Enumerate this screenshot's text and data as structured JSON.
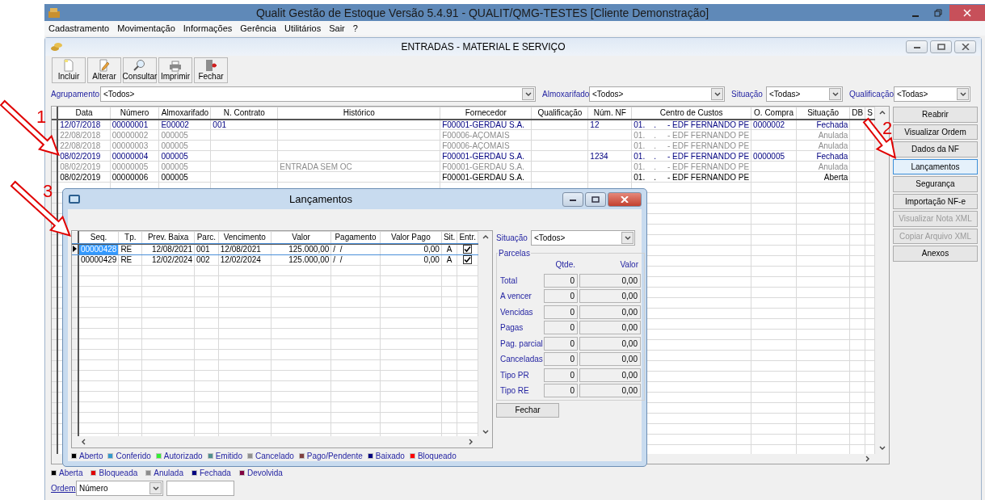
{
  "window": {
    "title": "Qualit Gestão de Estoque Versão 5.4.91 - QUALIT/QMG-TESTES [Cliente Demonstração]"
  },
  "menu": [
    "Cadastramento",
    "Movimentação",
    "Informações",
    "Gerência",
    "Utilitários",
    "Sair",
    "?"
  ],
  "child_window": {
    "title": "ENTRADAS - MATERIAL E SERVIÇO"
  },
  "toolbar": [
    {
      "label": "Incluir",
      "kind": "new"
    },
    {
      "label": "Alterar",
      "kind": "edit"
    },
    {
      "label": "Consultar",
      "kind": "search"
    },
    {
      "label": "Imprimir",
      "kind": "print"
    },
    {
      "label": "Fechar",
      "kind": "exit"
    }
  ],
  "filters": [
    {
      "label": "Agrupamento",
      "value": "<Todos>"
    },
    {
      "label": "Almoxarifado",
      "value": "<Todos>"
    },
    {
      "label": "Situação",
      "value": "<Todas>"
    },
    {
      "label": "Qualificação",
      "value": "<Todas>"
    }
  ],
  "table": {
    "columns": [
      "Data",
      "Número",
      "Almoxarifado",
      "N. Contrato",
      "Histórico",
      "Fornecedor",
      "Qualificação",
      "Núm. NF",
      "Centro de Custos",
      "O. Compra",
      "Situação",
      "DB",
      "S"
    ],
    "rows": [
      {
        "kind": "closed",
        "cells": [
          "12/07/2018",
          "00000001",
          "E00002",
          "001",
          "",
          "F00001-GERDAU S.A.",
          "",
          "12",
          "01.    .     - EDF FERNANDO PE",
          "0000002",
          "Fechada"
        ]
      },
      {
        "kind": "voided",
        "cells": [
          "22/08/2018",
          "00000002",
          "000005",
          "",
          "",
          "F00006-AÇOMAIS",
          "",
          "",
          "01.    .     - EDF FERNANDO PE",
          "",
          "Anulada"
        ]
      },
      {
        "kind": "voided",
        "cells": [
          "22/08/2018",
          "00000003",
          "000005",
          "",
          "",
          "F00006-AÇOMAIS",
          "",
          "",
          "01.    .     - EDF FERNANDO PE",
          "",
          "Anulada"
        ]
      },
      {
        "kind": "closed",
        "cells": [
          "08/02/2019",
          "00000004",
          "000005",
          "",
          "",
          "F00001-GERDAU S.A.",
          "",
          "1234",
          "01.    .     - EDF FERNANDO PE",
          "0000005",
          "Fechada"
        ]
      },
      {
        "kind": "voided",
        "cells": [
          "08/02/2019",
          "00000005",
          "000005",
          "",
          "ENTRADA SEM OC",
          "F00001-GERDAU S.A.",
          "",
          "",
          "01.    .     - EDF FERNANDO PE",
          "",
          "Anulada"
        ]
      },
      {
        "kind": "open",
        "cells": [
          "08/02/2019",
          "00000006",
          "000005",
          "",
          "",
          "F00001-GERDAU S.A.",
          "",
          "",
          "01.    .     - EDF FERNANDO PE",
          "",
          "Aberta"
        ]
      }
    ]
  },
  "side_buttons": [
    {
      "label": "Reabrir",
      "disabled": false,
      "focused": false
    },
    {
      "label": "Visualizar Ordem",
      "disabled": false,
      "focused": false
    },
    {
      "label": "Dados da NF",
      "disabled": false,
      "focused": false
    },
    {
      "label": "Lançamentos",
      "disabled": false,
      "focused": true
    },
    {
      "label": "Segurança",
      "disabled": false,
      "focused": false
    },
    {
      "label": "Importação NF-e",
      "disabled": false,
      "focused": false
    },
    {
      "label": "Visualizar Nota XML",
      "disabled": true,
      "focused": false
    },
    {
      "label": "Copiar Arquivo XML",
      "disabled": true,
      "focused": false
    },
    {
      "label": "Anexos",
      "disabled": false,
      "focused": false
    }
  ],
  "legend": [
    {
      "label": "Aberta",
      "color": "#000000"
    },
    {
      "label": "Bloqueada",
      "color": "#e00000"
    },
    {
      "label": "Anulada",
      "color": "#8c8c8c"
    },
    {
      "label": "Fechada",
      "color": "#000080"
    },
    {
      "label": "Devolvida",
      "color": "#800040"
    }
  ],
  "order": {
    "label": "Ordem",
    "value": "Número"
  },
  "dialog": {
    "title": "Lançamentos",
    "table": {
      "columns": [
        "Seq.",
        "Tp.",
        "Prev. Baixa",
        "Parc.",
        "Vencimento",
        "Valor",
        "Pagamento",
        "Valor Pago",
        "Sit.",
        "Entr."
      ],
      "rows": [
        {
          "selected": true,
          "checked": true,
          "cells": [
            "00000428",
            "RE",
            "12/08/2021",
            "001",
            "12/08/2021",
            "125.000,00",
            "/  /",
            "0,00",
            "A"
          ]
        },
        {
          "selected": false,
          "checked": true,
          "cells": [
            "00000429",
            "RE",
            "12/02/2024",
            "002",
            "12/02/2024",
            "125.000,00",
            "/  /",
            "0,00",
            "A"
          ]
        }
      ]
    },
    "status_filter": {
      "label": "Situação",
      "value": "<Todos>"
    },
    "summary": {
      "title": "Parcelas",
      "columns": [
        "Qtde.",
        "Valor"
      ],
      "rows": [
        {
          "label": "Total",
          "qty": "0",
          "value": "0,00"
        },
        {
          "label": "A vencer",
          "qty": "0",
          "value": "0,00"
        },
        {
          "label": "Vencidas",
          "qty": "0",
          "value": "0,00"
        },
        {
          "label": "Pagas",
          "qty": "0",
          "value": "0,00"
        },
        {
          "label": "Pag. parcial",
          "qty": "0",
          "value": "0,00"
        },
        {
          "label": "Canceladas",
          "qty": "0",
          "value": "0,00"
        },
        {
          "label": "Tipo PR",
          "qty": "0",
          "value": "0,00"
        },
        {
          "label": "Tipo RE",
          "qty": "0",
          "value": "0,00"
        }
      ]
    },
    "close_button": "Fechar",
    "legend": [
      {
        "label": "Aberto",
        "color": "#000000"
      },
      {
        "label": "Conferido",
        "color": "#3399cc"
      },
      {
        "label": "Autorizado",
        "color": "#33ee33"
      },
      {
        "label": "Emitido",
        "color": "#4f8f8f"
      },
      {
        "label": "Cancelado",
        "color": "#909090"
      },
      {
        "label": "Pago/Pendente",
        "color": "#804040"
      },
      {
        "label": "Baixado",
        "color": "#000080"
      },
      {
        "label": "Bloqueado",
        "color": "#ff0000"
      }
    ]
  },
  "annotations": [
    {
      "label": "1"
    },
    {
      "label": "2"
    },
    {
      "label": "3"
    }
  ]
}
